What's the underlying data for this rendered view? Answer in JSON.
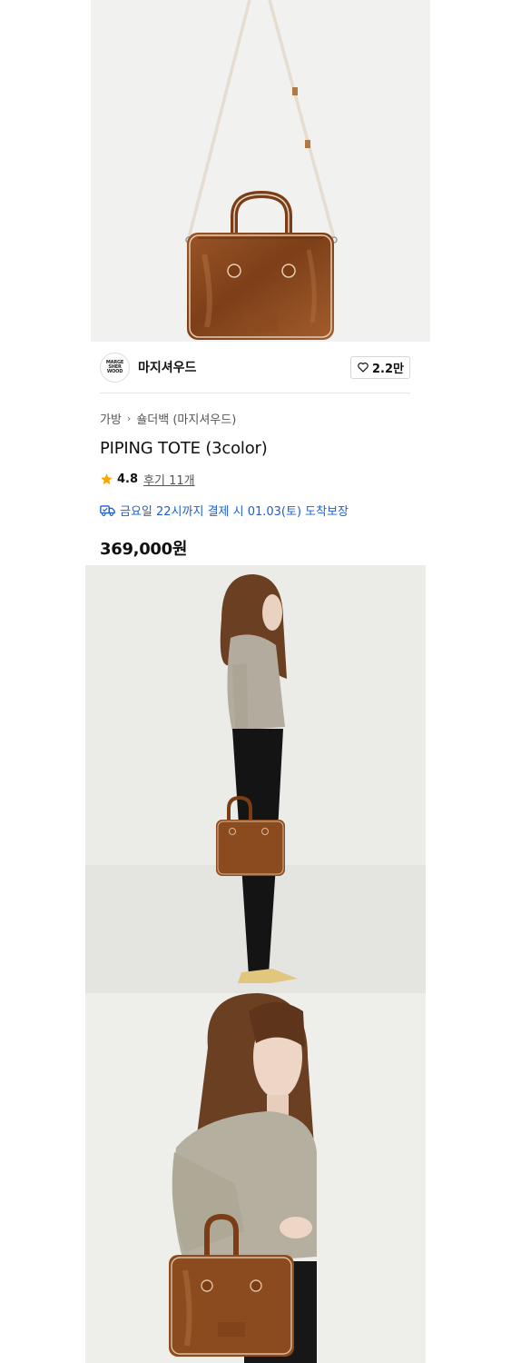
{
  "product": {
    "brand_logo_text": "MARGE\nSHER\nWOOD",
    "brand_name": "마지셔우드",
    "like_count": "2.2만",
    "breadcrumb": [
      "가방",
      "숄더백 (마지셔우드)"
    ],
    "breadcrumb_separator": "›",
    "title": "PIPING TOTE (3color)",
    "rating": "4.8",
    "reviews": "후기 11개",
    "delivery": "금요일 22시까지 결제 시 01.03(토) 도착보장",
    "price": "369,000원"
  },
  "colors": {
    "bag_brown": "#8a4a22",
    "delivery_blue": "#1f5fd1",
    "star_orange": "#f6a609"
  },
  "icons": {
    "like": "heart-outline-icon",
    "rating": "star-icon",
    "delivery": "truck-icon",
    "breadcrumb": "chevron-right-icon"
  }
}
